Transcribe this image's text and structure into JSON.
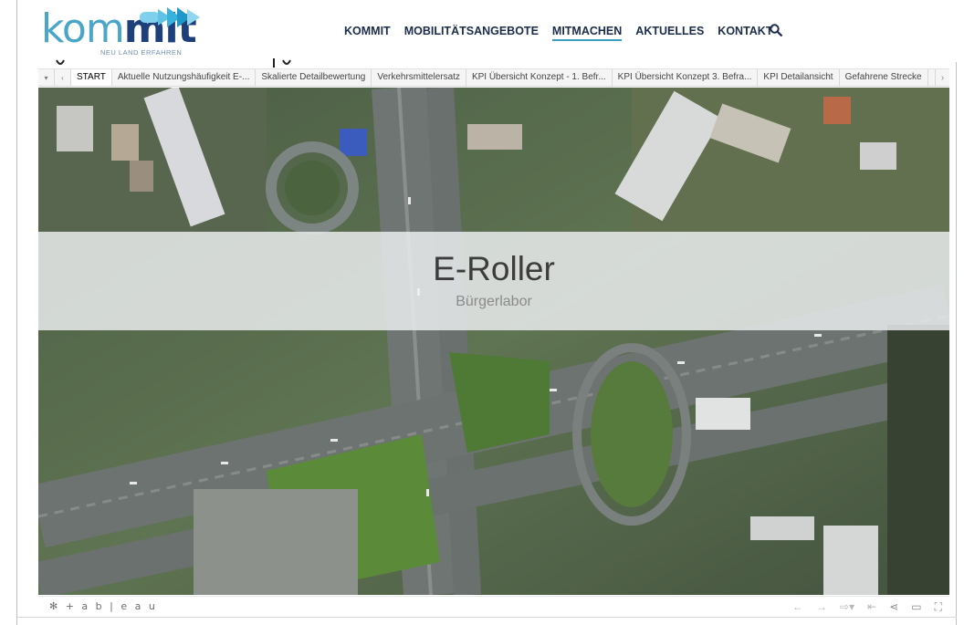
{
  "brand": {
    "logo_part1": "kom",
    "logo_part2": "mit",
    "tagline": "NEU LAND ERFAHREN",
    "colors": {
      "light_blue": "#4aa6c8",
      "dark_blue": "#1f3f7a",
      "nav_text": "#1c2c4a",
      "active_underline": "#3a9fc1"
    }
  },
  "nav": {
    "items": [
      {
        "label": "KOMMIT",
        "active": false
      },
      {
        "label": "MOBILITÄTSANGEBOTE",
        "active": false
      },
      {
        "label": "MITMACHEN",
        "active": true
      },
      {
        "label": "AKTUELLES",
        "active": false
      },
      {
        "label": "KONTAKT",
        "active": false
      }
    ],
    "search_icon": "search-icon"
  },
  "tabbar": {
    "controls": [
      "dropdown-icon",
      "prev-icon"
    ],
    "tabs": [
      {
        "label": "START",
        "active": true
      },
      {
        "label": "Aktuelle Nutzungshäufigkeit E-...",
        "active": false
      },
      {
        "label": "Skalierte Detailbewertung",
        "active": false
      },
      {
        "label": "Verkehrsmittelersatz",
        "active": false
      },
      {
        "label": "KPI Übersicht Konzept - 1. Befr...",
        "active": false
      },
      {
        "label": "KPI Übersicht Konzept 3. Befra...",
        "active": false
      },
      {
        "label": "KPI Detailansicht",
        "active": false
      },
      {
        "label": "Gefahrene Strecke",
        "active": false
      }
    ],
    "next_icon": "next-icon"
  },
  "hero": {
    "title": "E-Roller",
    "subtitle": "Bürgerlabor"
  },
  "footer": {
    "tableau_label": "+ a b | e a u",
    "tools": [
      "undo-icon",
      "redo-icon",
      "revert-icon",
      "reset-icon",
      "share-icon",
      "comment-icon",
      "fullscreen-icon"
    ]
  }
}
